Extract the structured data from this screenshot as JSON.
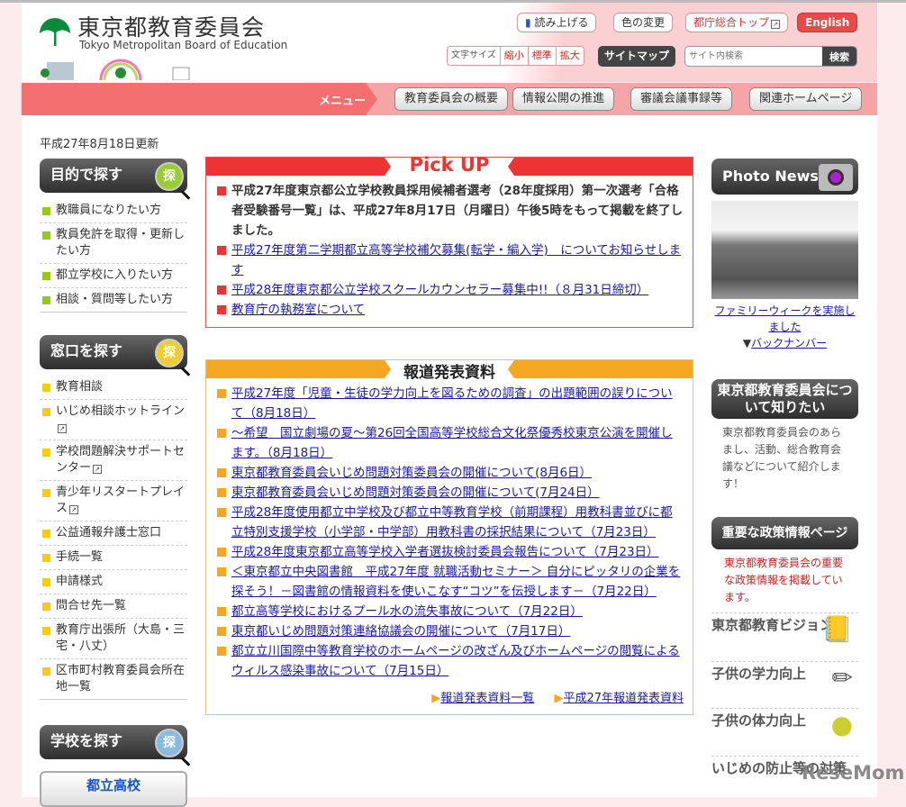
{
  "header": {
    "org_name": "東京都教育委員会",
    "org_name_en": "Tokyo Metropolitan Board of Education",
    "buttons": {
      "read_aloud": "読み上げる",
      "color_change": "色の変更",
      "metro_top": "都庁総合トップ",
      "english": "English"
    },
    "font_size": {
      "label": "文字サイズ",
      "small": "縮小",
      "standard": "標準",
      "large": "拡大"
    },
    "sitemap": "サイトマップ",
    "search_placeholder": "サイト内検索",
    "search_button": "検索"
  },
  "nav": {
    "menu_label": "メニュー",
    "items": [
      "教育委員会の概要",
      "情報公開の推進",
      "審議会議事録等",
      "関連ホームページ"
    ]
  },
  "updated": "平成27年8月18日更新",
  "left": {
    "purpose": {
      "title": "目的で探す",
      "lens": "探",
      "items": [
        "教職員になりたい方",
        "教員免許を取得・更新したい方",
        "都立学校に入りたい方",
        "相談・質問等したい方"
      ]
    },
    "window": {
      "title": "窓口を探す",
      "lens": "探",
      "items": [
        "教育相談",
        "いじめ相談ホットライン",
        "学校問題解決サポートセンター",
        "青少年リスタートプレイス",
        "公益通報弁護士窓口",
        "手続一覧",
        "申請様式",
        "問合せ先一覧",
        "教育庁出張所（大島・三宅・八丈）",
        "区市町村教育委員会所在地一覧"
      ]
    },
    "school": {
      "title": "学校を探す",
      "lens": "探",
      "button": "都立高校"
    }
  },
  "pickup": {
    "title": "Pick UP",
    "items": [
      {
        "text": "平成27年度東京都公立学校教員採用候補者選考（28年度採用）第一次選考「合格者受験番号一覧」は、平成27年8月17日（月曜日）午後5時をもって掲載を終了しました。",
        "link": false
      },
      {
        "text": "平成27年度第二学期都立高等学校補欠募集(転学・編入学)　についてお知らせします",
        "link": true
      },
      {
        "text": "平成28年度東京都公立学校スクールカウンセラー募集中!!（８月31日締切）",
        "link": true
      },
      {
        "text": "教育庁の執務室について",
        "link": true
      }
    ]
  },
  "press": {
    "title": "報道発表資料",
    "items": [
      "平成27年度「児童・生徒の学力向上を図るための調査」の出題範囲の誤りについて（8月18日）",
      "～希望　国立劇場の夏～第26回全国高等学校総合文化祭優秀校東京公演を開催します。（8月18日）",
      "東京都教育委員会いじめ問題対策委員会の開催について(8月6日）",
      "東京都教育委員会いじめ問題対策委員会の開催について(7月24日）",
      "平成28年度使用都立中学校及び都立中等教育学校（前期課程）用教科書並びに都立特別支援学校（小学部・中学部）用教科書の採択結果について（7月23日）",
      "平成28年度東京都立高等学校入学者選抜検討委員会報告について（7月23日）",
      "＜東京都立中央図書館　平成27年度 就職活動セミナー＞ 自分にピッタリの企業を探そう！－図書館の情報資料を使いこなす“コツ”を伝授します－（7月22日）",
      "都立高等学校におけるプール水の流失事故について（7月22日）",
      "東京都いじめ問題対策連絡協議会の開催について（7月17日）",
      "都立立川国際中等教育学校のホームページの改ざん及びホームページの閲覧によるウィルス感染事故について（7月15日）"
    ],
    "more": [
      "報道発表資料一覧",
      "平成27年報道発表資料"
    ]
  },
  "right": {
    "photo_news": {
      "title": "Photo News",
      "caption": "ファミリーウィークを実施しました",
      "back": "バックナンバー"
    },
    "about": {
      "title": "東京都教育委員会について知りたい",
      "text": "東京都教育委員会のあらまし、活動、総合教育会議などについて紹介します！"
    },
    "policy": {
      "title": "重要な政策情報ページ",
      "text": "東京都教育委員会の重要な政策情報を掲載しています。",
      "items": [
        "東京都教育ビジョン",
        "子供の学力向上",
        "子供の体力向上",
        "いじめの防止等の対策"
      ]
    }
  },
  "watermark": "ReseMom",
  "colors": {
    "nav_red": "#f46f6f",
    "pickup_red": "#e33333",
    "press_orange": "#f5a623",
    "link": "#1a1aa6",
    "green_bullet": "#99cc00",
    "yellow_bullet": "#ffcc00"
  }
}
